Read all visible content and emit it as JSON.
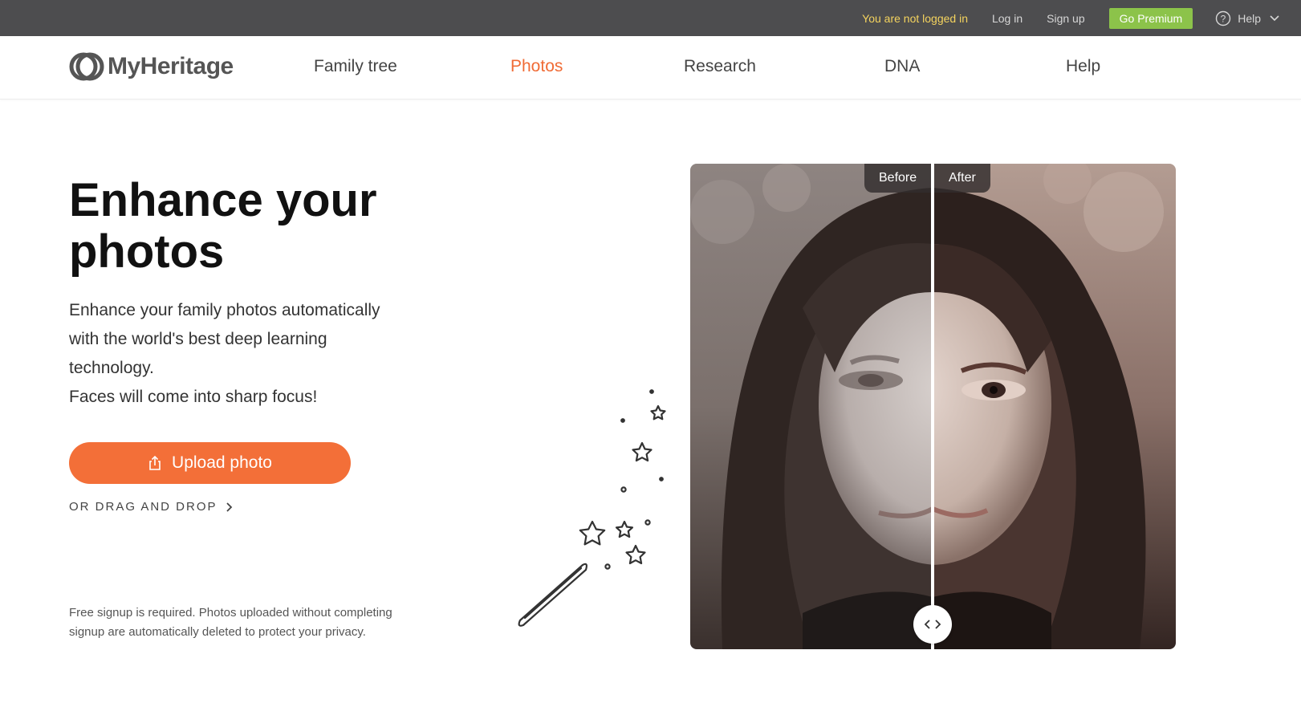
{
  "topbar": {
    "notice": "You are not logged in",
    "login": "Log in",
    "signup": "Sign up",
    "premium": "Go Premium",
    "help": "Help",
    "colors": {
      "background": "#4d4d4f",
      "notice": "#f4d35e",
      "premium": "#8cc34a"
    }
  },
  "nav": {
    "logo": "MyHeritage",
    "items": [
      {
        "label": "Family tree"
      },
      {
        "label": "Photos",
        "active": true
      },
      {
        "label": "Research"
      },
      {
        "label": "DNA"
      },
      {
        "label": "Help"
      }
    ],
    "accent_color": "#f06b35"
  },
  "hero": {
    "title_line1": "Enhance your",
    "title_line2": "photos",
    "desc_line1": "Enhance your family photos automatically",
    "desc_line2": "with the world's best deep learning",
    "desc_line3": "technology.",
    "desc_line4": "Faces will come into sharp focus!",
    "upload_label": "Upload photo",
    "drag_label": "OR DRAG AND DROP",
    "disclaimer_line1": "Free signup is required. Photos uploaded without completing",
    "disclaimer_line2": "signup are automatically deleted to protect your privacy.",
    "button_color": "#f36f38"
  },
  "compare": {
    "before_label": "Before",
    "after_label": "After",
    "icons": [
      "chevron-left-icon",
      "chevron-right-icon"
    ]
  }
}
